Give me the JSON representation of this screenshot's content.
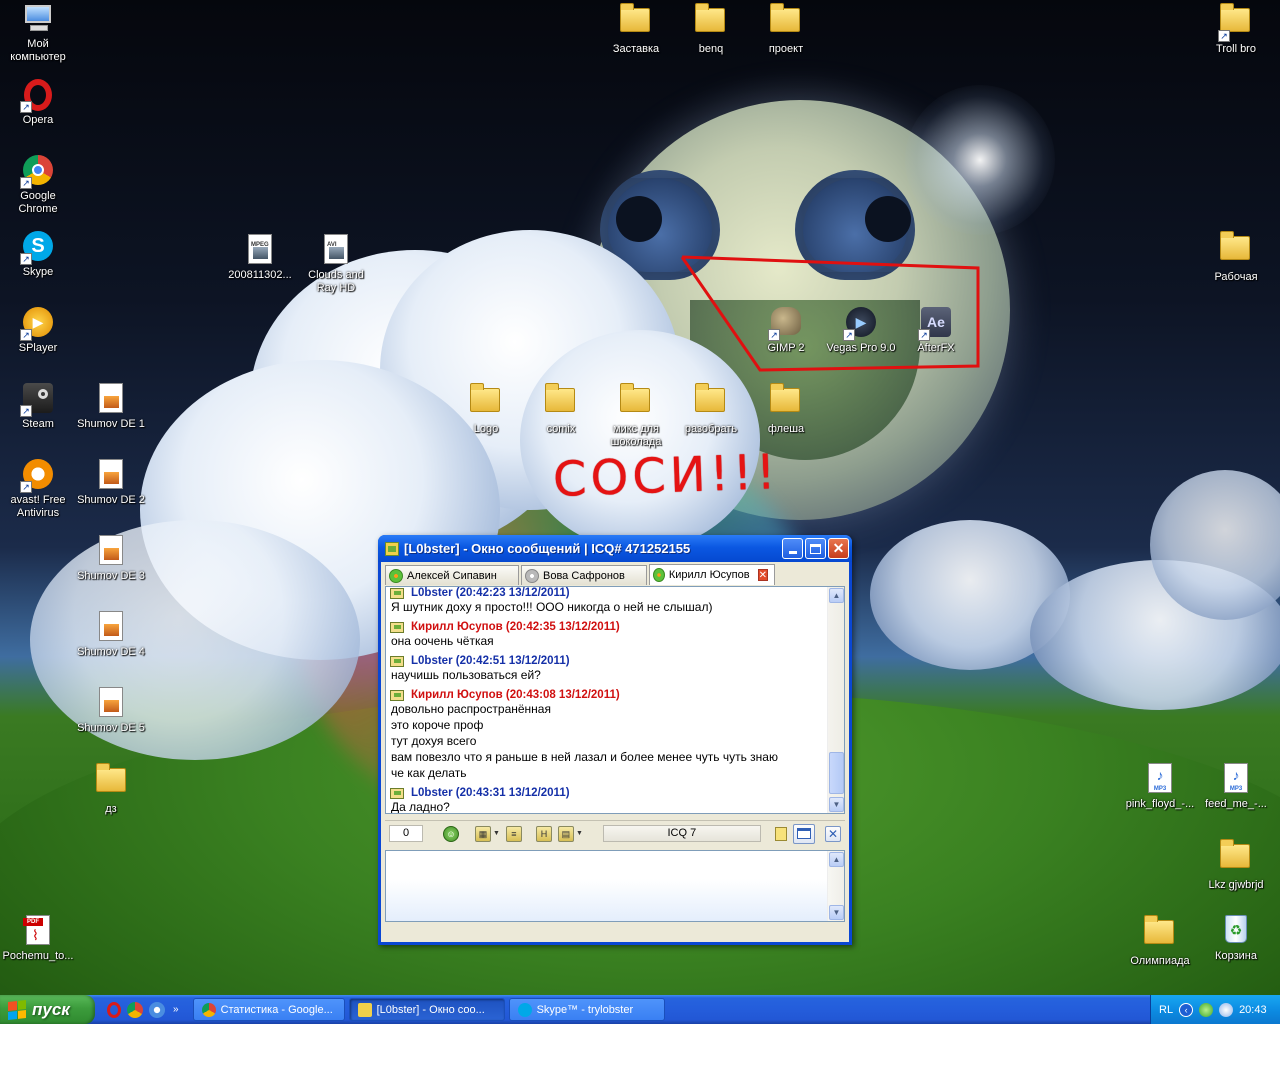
{
  "desktop": {
    "annotation_text": "СОСИ!!!",
    "icons": {
      "my_computer": "Мой компьютер",
      "opera": "Opera",
      "chrome": "Google Chrome",
      "skype": "Skype",
      "splayer": "SPlayer",
      "steam": "Steam",
      "avast": "avast! Free Antivirus",
      "pdf": "Pochemu_to...",
      "mpeg": "200811302...",
      "avi": "Clouds and Ray HD",
      "shumov1": "Shumov DE 1",
      "shumov2": "Shumov DE 2",
      "shumov3": "Shumov DE 3",
      "shumov4": "Shumov DE 4",
      "shumov5": "Shumov DE 5",
      "dz": "дз",
      "zastavka": "Заставка",
      "benq": "benq",
      "proekt": "проект",
      "troll": "Troll bro",
      "rabochaya": "Рабочая",
      "gimp": "GIMP 2",
      "vegas": "Vegas Pro 9.0",
      "afterfx": "AfterFX",
      "logo": "Logo",
      "comix": "comix",
      "miks": "микс для шоколада",
      "razobrat": "разобрать",
      "flesha": "флеша",
      "pink_floyd": "pink_floyd_-...",
      "feed_me": "feed_me_-...",
      "lkz": "Lkz gjwbrjd",
      "olimpiada": "Олимпиада",
      "korzina": "Корзина"
    }
  },
  "icq": {
    "title": "[L0bster] - Окно сообщений | ICQ# 471252155",
    "tabs": [
      {
        "label": "Алексей Сипавин"
      },
      {
        "label": "Вова Сафронов"
      },
      {
        "label": "Кирилл Юсупов"
      }
    ],
    "messages": [
      {
        "from": "L0bster (20:42:23 13/12/2011)",
        "lines": [
          "Я шутник доху я просто!!! ООО никогда о ней не слышал)"
        ]
      },
      {
        "from": "Кирилл Юсупов (20:42:35 13/12/2011)",
        "lines": [
          "она оочень чёткая"
        ]
      },
      {
        "from": "L0bster (20:42:51 13/12/2011)",
        "lines": [
          "научишь пользоваться ей?"
        ]
      },
      {
        "from": "Кирилл Юсупов (20:43:08 13/12/2011)",
        "lines": [
          "довольно распространённая",
          "это короче проф",
          "тут дохуя всего",
          "вам повезло что я раньше в ней лазал и более менее чуть чуть знаю",
          "че как делать"
        ]
      },
      {
        "from": "L0bster (20:43:31 13/12/2011)",
        "lines": [
          "Да ладно?"
        ]
      }
    ],
    "toolbar": {
      "char_count": "0",
      "protocol": "ICQ 7"
    },
    "input_value": ""
  },
  "taskbar": {
    "start_label": "пуск",
    "tasks": [
      {
        "label": "Статистика - Google..."
      },
      {
        "label": "[L0bster] - Окно соо..."
      },
      {
        "label": "Skype™ - trylobster"
      }
    ],
    "tray": {
      "lang": "RL",
      "clock": "20:43"
    }
  }
}
